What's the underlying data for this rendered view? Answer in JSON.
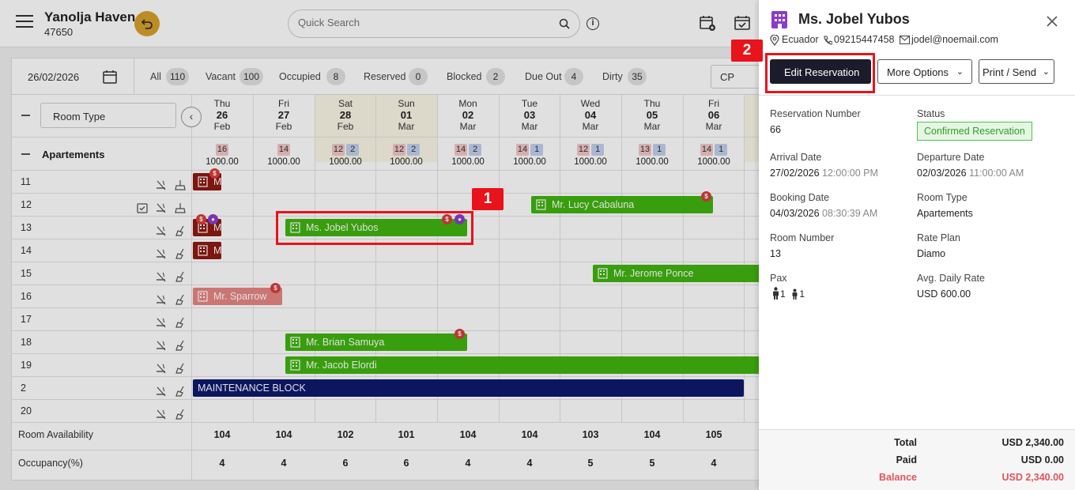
{
  "header": {
    "hotel_name": "Yanolja Haven",
    "hotel_id": "47650",
    "search_placeholder": "Quick Search"
  },
  "filters": {
    "date": "26/02/2026",
    "chips": [
      {
        "label": "All",
        "count": "110"
      },
      {
        "label": "Vacant",
        "count": "100"
      },
      {
        "label": "Occupied",
        "count": "8"
      },
      {
        "label": "Reserved",
        "count": "0"
      },
      {
        "label": "Blocked",
        "count": "2"
      },
      {
        "label": "Due Out",
        "count": "4"
      },
      {
        "label": "Dirty",
        "count": "35"
      }
    ],
    "rate_code": "CP"
  },
  "grid": {
    "room_type_select": "Room Type",
    "days": [
      {
        "name": "Thu",
        "date": "26",
        "month": "Feb",
        "red": "16",
        "blue": "",
        "rate": "1000.00"
      },
      {
        "name": "Fri",
        "date": "27",
        "month": "Feb",
        "red": "14",
        "blue": "",
        "rate": "1000.00"
      },
      {
        "name": "Sat",
        "date": "28",
        "month": "Feb",
        "red": "12",
        "blue": "2",
        "rate": "1000.00"
      },
      {
        "name": "Sun",
        "date": "01",
        "month": "Mar",
        "red": "12",
        "blue": "2",
        "rate": "1000.00"
      },
      {
        "name": "Mon",
        "date": "02",
        "month": "Mar",
        "red": "14",
        "blue": "2",
        "rate": "1000.00"
      },
      {
        "name": "Tue",
        "date": "03",
        "month": "Mar",
        "red": "14",
        "blue": "1",
        "rate": "1000.00"
      },
      {
        "name": "Wed",
        "date": "04",
        "month": "Mar",
        "red": "12",
        "blue": "1",
        "rate": "1000.00"
      },
      {
        "name": "Thu",
        "date": "05",
        "month": "Mar",
        "red": "13",
        "blue": "1",
        "rate": "1000.00"
      },
      {
        "name": "Fri",
        "date": "06",
        "month": "Mar",
        "red": "14",
        "blue": "1",
        "rate": "1000.00"
      }
    ],
    "group": "Apartements",
    "rooms": [
      "11",
      "12",
      "13",
      "14",
      "15",
      "16",
      "17",
      "18",
      "19",
      "2",
      "20"
    ],
    "reservations": {
      "lucy": "Mr. Lucy Cabaluna",
      "jobel": "Ms. Jobel Yubos",
      "jerome": "Mr. Jerome Ponce",
      "sparrow": "Mr. Sparrow",
      "brian": "Mr. Brian Samuya",
      "jacob": "Mr. Jacob Elordi",
      "maintenance": "MAINTENANCE BLOCK",
      "stub_letter": "M"
    },
    "footer": {
      "availability_label": "Room Availability",
      "availability": [
        "104",
        "104",
        "102",
        "101",
        "104",
        "104",
        "103",
        "104",
        "105"
      ],
      "occupancy_label": "Occupancy(%)",
      "occupancy": [
        "4",
        "4",
        "6",
        "6",
        "4",
        "4",
        "5",
        "5",
        "4"
      ]
    }
  },
  "callouts": {
    "one": "1",
    "two": "2"
  },
  "drawer": {
    "guest_name": "Ms. Jobel Yubos",
    "country": "Ecuador",
    "phone": "09215447458",
    "email": "jodel@noemail.com",
    "buttons": {
      "edit": "Edit Reservation",
      "more": "More Options",
      "print": "Print / Send"
    },
    "fields": {
      "reservation_number_label": "Reservation Number",
      "reservation_number": "66",
      "status_label": "Status",
      "status": "Confirmed Reservation",
      "arrival_label": "Arrival Date",
      "arrival_date": "27/02/2026",
      "arrival_time": "12:00:00 PM",
      "departure_label": "Departure Date",
      "departure_date": "02/03/2026",
      "departure_time": "11:00:00 AM",
      "booking_label": "Booking Date",
      "booking_date": "04/03/2026",
      "booking_time": "08:30:39 AM",
      "room_type_label": "Room Type",
      "room_type": "Apartements",
      "room_number_label": "Room Number",
      "room_number": "13",
      "rate_plan_label": "Rate Plan",
      "rate_plan": "Diamo",
      "pax_label": "Pax",
      "pax_adults": "1",
      "pax_children": "1",
      "adr_label": "Avg. Daily Rate",
      "adr": "USD 600.00"
    },
    "totals": {
      "total_label": "Total",
      "total": "USD 2,340.00",
      "paid_label": "Paid",
      "paid": "USD 0.00",
      "balance_label": "Balance",
      "balance": "USD 2,340.00"
    }
  },
  "colors": {
    "reservation_green": "#40b40f",
    "block_navy": "#0d1a6d",
    "highlight_red": "#e8131b",
    "status_green": "#2e9e2a",
    "balance_red": "#e2555b"
  }
}
